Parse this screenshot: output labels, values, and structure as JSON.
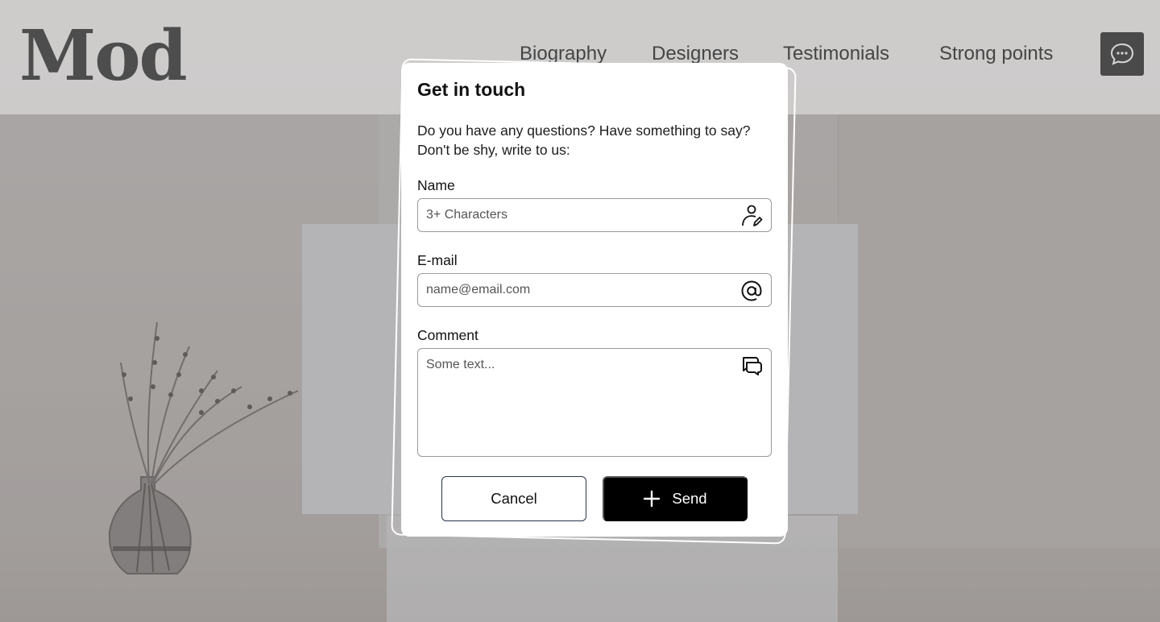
{
  "header": {
    "logo": "Mod",
    "nav": [
      {
        "label": "Biography"
      },
      {
        "label": "Designers"
      },
      {
        "label": "Testimonials"
      },
      {
        "label": "Strong points"
      }
    ]
  },
  "modal": {
    "title": "Get in touch",
    "description": "Do you have any questions? Have something to say? Don't be shy, write to us:",
    "fields": {
      "name": {
        "label": "Name",
        "placeholder": "3+ Characters"
      },
      "email": {
        "label": "E-mail",
        "placeholder": "name@email.com"
      },
      "comment": {
        "label": "Comment",
        "placeholder": "Some text..."
      }
    },
    "cancel_label": "Cancel",
    "send_label": "Send"
  },
  "icons": {
    "header_chat": "chat-bubble-icon",
    "name": "user-edit-icon",
    "email": "at-sign-icon",
    "comment": "comments-icon",
    "send": "plus-icon"
  }
}
